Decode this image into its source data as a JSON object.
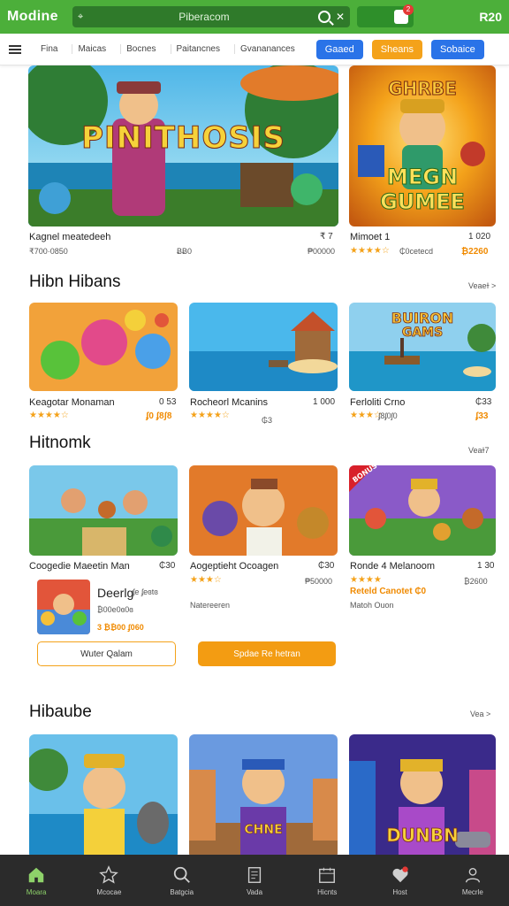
{
  "header": {
    "brand": "Modine",
    "search_loc": "⌖",
    "search_text": "Piberacom",
    "close": "✕",
    "bag_count": "2",
    "price": "R20"
  },
  "nav": {
    "tabs": [
      "Fina",
      "Maicas",
      "Bocnes",
      "Paitancnes",
      "Gvananances"
    ],
    "pills": [
      "Gaaed",
      "Sheans",
      "Sobaice"
    ]
  },
  "featured": [
    {
      "title": "Kagnel meatedeeh",
      "num": "₹ 7",
      "meta": "₹700·0850",
      "meta2": "ɃɃ0",
      "metar": "₱00000",
      "art_text": "PINITHOSIS"
    },
    {
      "title": "Mimoet 1",
      "num": "1 020",
      "stars": "★★★★☆",
      "meta": "₵0cetecd",
      "orange": "₿2260",
      "art_text1": "GHRBE",
      "art_text2": "MEGN",
      "art_text3": "GUMEE"
    }
  ],
  "section1": {
    "title": "Hibn Hibans",
    "see": "Veaeɫ >"
  },
  "row1": [
    {
      "title": "Keagotar Monaman",
      "num": "0 53",
      "stars": "★★★★☆",
      "orange": "ʄ0 ʄ8ʃ8"
    },
    {
      "title": "Rocheorl Mcanins",
      "num": "1 000",
      "stars": "★★★★☆",
      "meta": "₲3"
    },
    {
      "title": "Ferloliti Crno",
      "num": "₵33",
      "stars": "★★★☆",
      "meta": "ʄ8ʄ0ʃ0",
      "orange": "ʄ33",
      "art_text1": "BUIRON",
      "art_text2": "GAMS"
    }
  ],
  "section2": {
    "title": "Hitnomk",
    "see": "Veaɫ7"
  },
  "row2": [
    {
      "title": "Coogedie Maeetin Man",
      "num": "₵30"
    },
    {
      "title": "Aogeptieht Ocoagen",
      "num": "₵30",
      "stars": "★★★☆",
      "meta": "₱50000",
      "meta2": "Natereeren"
    },
    {
      "title": "Ronde 4 Melanoom",
      "num": "1 30",
      "stars": "★★★★",
      "orange": "Reteld Canotet  ₵0",
      "meta": "₿2600",
      "meta2": "Matoh Ouon",
      "art_text": "BONUS"
    }
  ],
  "popup": {
    "title": "Deerlg",
    "line1": "ʄe ʄeɞtɞ",
    "line2": "₿00e0ɞ0ɞ",
    "price": "3 ₿₿00 ʄ060",
    "btn_outline": "Wuter Qalam",
    "btn_solid": "Spdae Re hetran"
  },
  "section3": {
    "title": "Hibaube",
    "see": "Vea >"
  },
  "row3": [
    {
      "art": "tropic"
    },
    {
      "art": "city",
      "art_text": "CHNE"
    },
    {
      "art": "night",
      "art_text": "DUNBN"
    }
  ],
  "bottom_nav": [
    "Moara",
    "Mcocae",
    "Batgcia",
    "Vada",
    "Hicnts",
    "Host",
    "Mecrle"
  ],
  "colors": {
    "primary": "#4caf3a",
    "accent": "#f4a21a",
    "blue": "#2a73e8",
    "bottom": "#2b2b2b"
  }
}
